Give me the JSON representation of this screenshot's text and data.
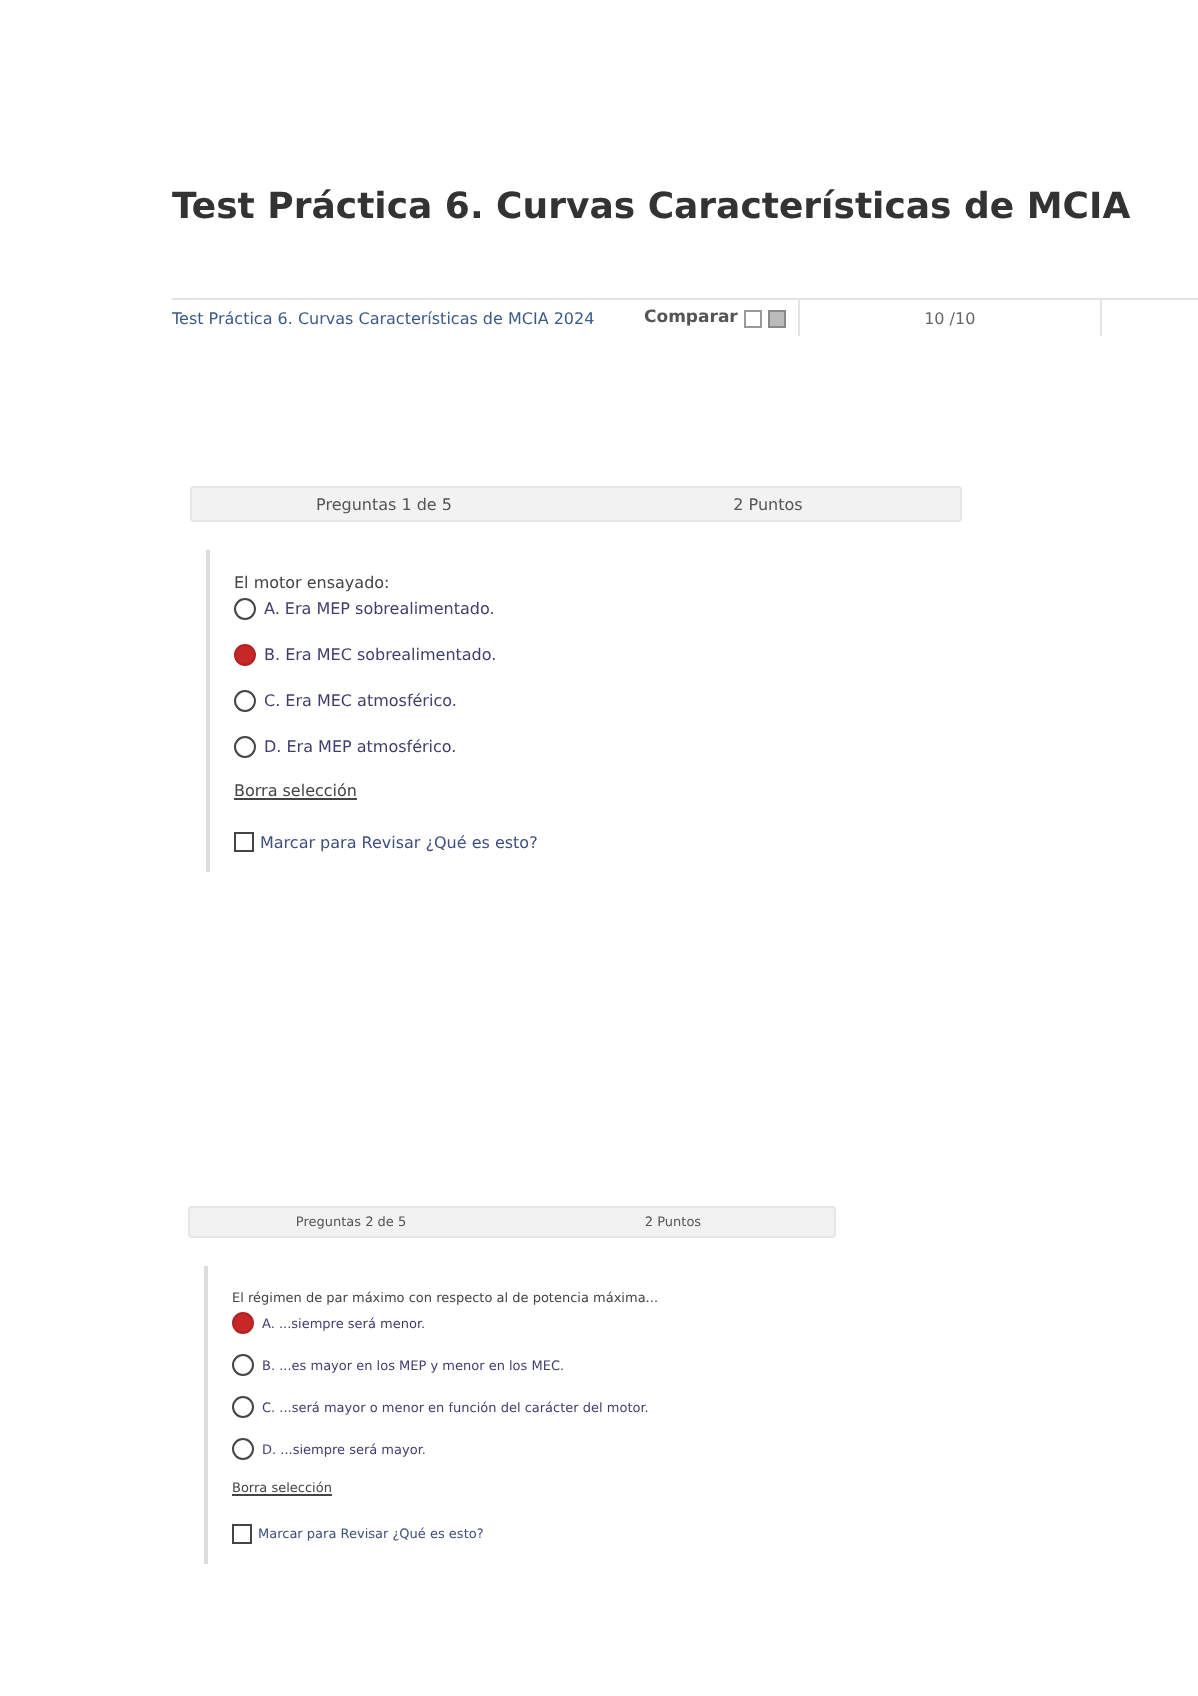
{
  "page_title": "Test Práctica 6. Curvas Características de MCIA",
  "summary_row": {
    "test_name": "Test Práctica 6. Curvas Características de MCIA 2024",
    "compare_label": "Comparar",
    "score": "10 /10"
  },
  "questions": [
    {
      "header": "Preguntas 1 de 5",
      "points": "2 Puntos",
      "prompt": "El motor ensayado:",
      "options": [
        {
          "label": "A. Era MEP sobrealimentado.",
          "selected": false
        },
        {
          "label": "B. Era MEC sobrealimentado.",
          "selected": true
        },
        {
          "label": "C. Era MEC atmosférico.",
          "selected": false
        },
        {
          "label": "D. Era MEP atmosférico.",
          "selected": false
        }
      ],
      "clear_link": "Borra selección",
      "review_label": "Marcar para Revisar ¿Qué es esto?",
      "review_checked": false
    },
    {
      "header": "Preguntas 2 de 5",
      "points": "2 Puntos",
      "prompt": "El régimen de par máximo con respecto al de potencia máxima...",
      "options": [
        {
          "label": "A. ...siempre será menor.",
          "selected": true
        },
        {
          "label": "B. ...es mayor en los MEP y menor en los MEC.",
          "selected": false
        },
        {
          "label": "C. ...será mayor o menor en función del carácter del motor.",
          "selected": false
        },
        {
          "label": "D. ...siempre será mayor.",
          "selected": false
        }
      ],
      "clear_link": "Borra selección",
      "review_label": "Marcar para Revisar ¿Qué es esto?",
      "review_checked": false
    }
  ]
}
